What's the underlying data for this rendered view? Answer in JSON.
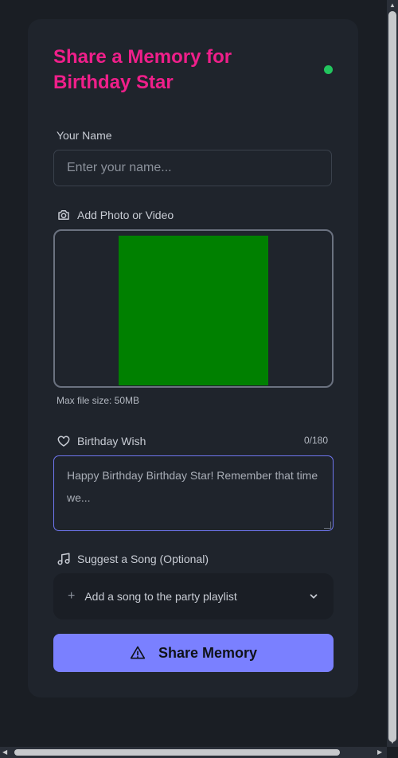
{
  "form": {
    "title": "Share a Memory for Birthday Star",
    "status_color": "#22c55e",
    "name_label": "Your Name",
    "name_placeholder": "Enter your name...",
    "media_label": "Add Photo or Video",
    "media_hint": "Max file size: 50MB",
    "media_preview_color": "#008000",
    "wish_label": "Birthday Wish",
    "wish_counter": "0/180",
    "wish_placeholder": "Happy Birthday Birthday Star! Remember that time we...",
    "song_label": "Suggest a Song (Optional)",
    "song_add_label": "Add a song to the party playlist",
    "submit_label": "Share Memory"
  },
  "colors": {
    "title": "#ef1f8a",
    "accent": "#7a80ff",
    "background": "#1a1e24",
    "card": "#1f242c"
  },
  "icons": {
    "media": "camera-icon",
    "wish": "heart-icon",
    "song": "music-icon",
    "song_add": "plus-icon",
    "song_expand": "chevron-down-icon",
    "submit": "warning-triangle-icon"
  }
}
